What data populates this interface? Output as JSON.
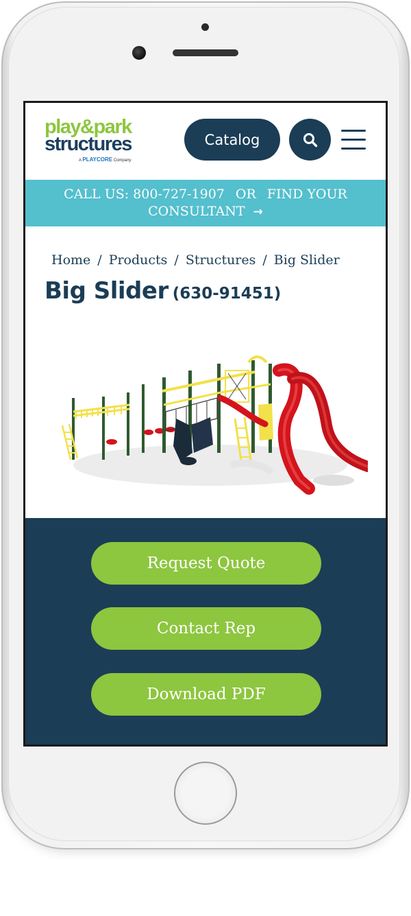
{
  "header": {
    "logo": {
      "line1": "play&park",
      "line2": "structures",
      "tagline_prefix": "A",
      "tagline_brand": "PLAYCORE",
      "tagline_suffix": "Company"
    },
    "catalog_label": "Catalog",
    "search_icon": "search-icon",
    "menu_icon": "hamburger-menu-icon"
  },
  "callbar": {
    "call_text": "CALL US: 800-727-1907",
    "or_text": "OR",
    "find_text": "FIND YOUR",
    "consultant_text": "CONSULTANT",
    "arrow": "→"
  },
  "breadcrumb": {
    "items": [
      "Home",
      "Products",
      "Structures",
      "Big Slider"
    ],
    "separator": "/"
  },
  "product": {
    "name": "Big Slider",
    "code": "(630-91451)"
  },
  "actions": {
    "request_quote": "Request Quote",
    "contact_rep": "Contact Rep",
    "download_pdf": "Download PDF"
  },
  "colors": {
    "navy": "#1b3d56",
    "green": "#8dc63f",
    "teal": "#54bfcd",
    "slide_red": "#d4141c"
  }
}
